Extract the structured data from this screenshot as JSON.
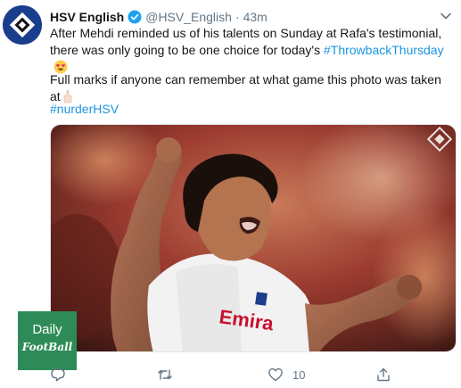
{
  "tweet": {
    "author_name": "HSV English",
    "handle": "@HSV_English",
    "separator": "·",
    "time": "43m",
    "text_line1": "After Mehdi reminded us of his talents on Sunday at Rafa's testimonial, there was only going to be one choice for today's ",
    "hashtag1": "#ThrowbackThursday",
    "text_line2": "Full marks if anyone can remember at what game this photo was taken at",
    "hashtag2": "#nurderHSV",
    "likes": "10",
    "photo_shirt_text": "Emira"
  },
  "watermark": {
    "line1": "Daily",
    "line2": "FootBall",
    "color": "#2e8b57"
  },
  "icons": {
    "verified": "verified-badge-icon",
    "chevron": "chevron-down-icon",
    "reply": "reply-icon",
    "retweet": "retweet-icon",
    "like": "heart-icon",
    "share": "share-icon"
  },
  "colors": {
    "link": "#1b95e0",
    "muted": "#657786",
    "avatar_blue": "#1a3e8c"
  }
}
